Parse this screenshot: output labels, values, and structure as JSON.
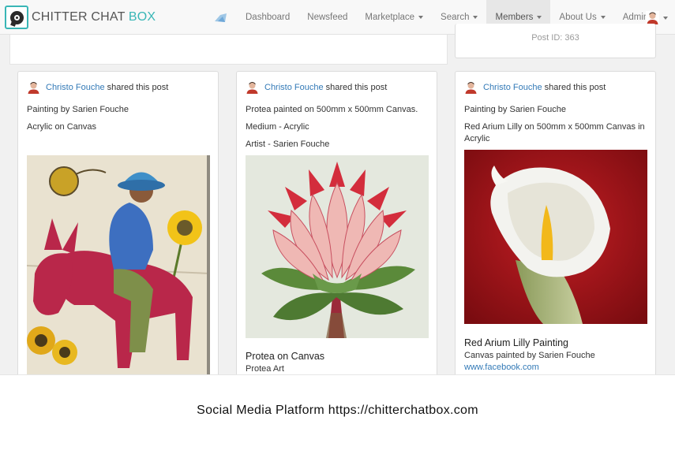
{
  "brand": {
    "name_main": "CHITTER CHAT ",
    "name_accent": "BOX"
  },
  "nav": {
    "items": [
      {
        "label": "Dashboard",
        "dropdown": false
      },
      {
        "label": "Newsfeed",
        "dropdown": false
      },
      {
        "label": "Marketplace",
        "dropdown": true
      },
      {
        "label": "Search",
        "dropdown": true
      },
      {
        "label": "Members",
        "dropdown": true,
        "active": true
      },
      {
        "label": "About Us",
        "dropdown": true
      },
      {
        "label": "Admin",
        "dropdown": true
      }
    ]
  },
  "top_card": {
    "post_id": "Post ID: 363"
  },
  "posts": [
    {
      "user": "Christo Fouche",
      "action": "shared this post",
      "lines": [
        "Painting by Sarien Fouche",
        "Acrylic on Canvas"
      ],
      "image_icon": "donkey-rider-painting"
    },
    {
      "user": "Christo Fouche",
      "action": "shared this post",
      "lines": [
        "Protea painted on 500mm x 500mm Canvas.",
        "Medium - Acrylic",
        "Artist - Sarien Fouche"
      ],
      "image_icon": "protea-painting",
      "footer_title": "Protea on Canvas",
      "footer_sub": "Protea Art"
    },
    {
      "user": "Christo Fouche",
      "action": "shared this post",
      "lines": [
        "Painting by Sarien Fouche",
        "Red Arium Lilly on 500mm x 500mm Canvas in Acrylic"
      ],
      "image_icon": "arum-lily-painting",
      "footer_title": "Red Arium Lilly Painting",
      "footer_sub": "Canvas painted by Sarien Fouche",
      "footer_link": "www.facebook.com"
    }
  ],
  "caption": "Social Media Platform https://chitterchatbox.com",
  "colors": {
    "accent": "#39b6b6",
    "link": "#337ab7",
    "active_nav": "#e7e7e7"
  }
}
